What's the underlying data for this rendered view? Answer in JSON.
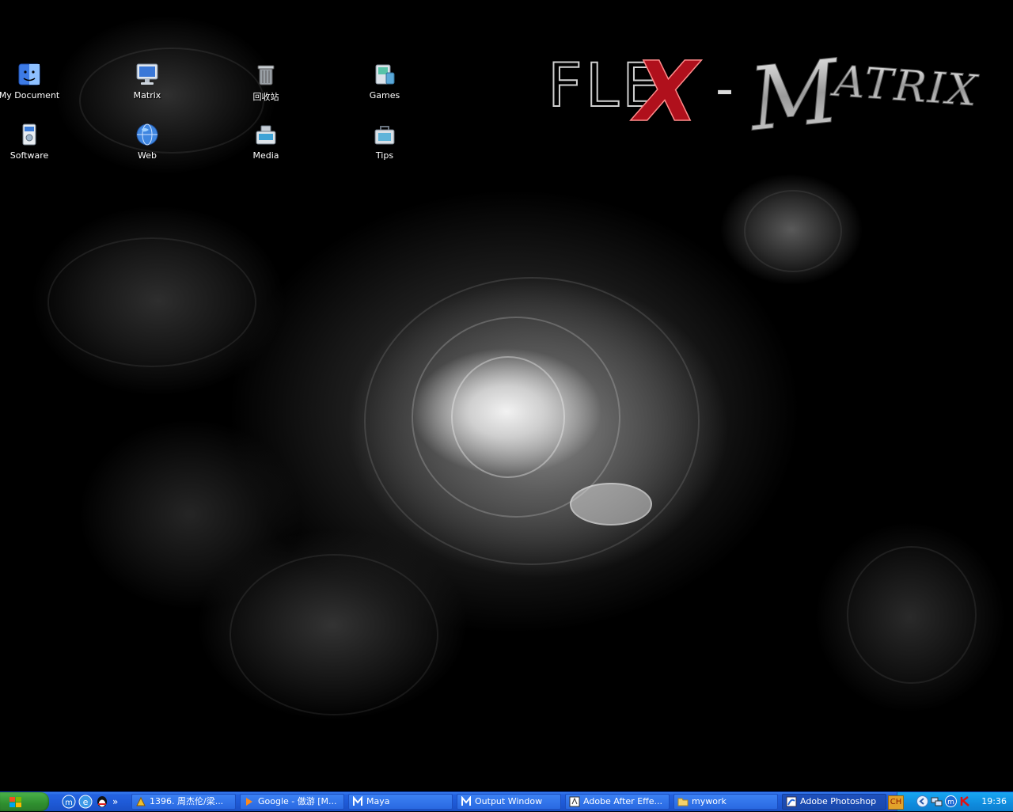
{
  "desktop": {
    "icons": [
      {
        "label": "My Document",
        "icon": "finder-icon"
      },
      {
        "label": "Matrix",
        "icon": "computer-icon"
      },
      {
        "label": "回收站",
        "icon": "trash-icon"
      },
      {
        "label": "Games",
        "icon": "games-icon"
      },
      {
        "label": "Software",
        "icon": "software-icon"
      },
      {
        "label": "Web",
        "icon": "globe-icon"
      },
      {
        "label": "Media",
        "icon": "media-icon"
      },
      {
        "label": "Tips",
        "icon": "toolbox-icon"
      }
    ],
    "logo": {
      "part1": "FLE",
      "part2": "X",
      "part3": "-",
      "part4": "ATRIX",
      "letter_m": "M"
    }
  },
  "taskbar": {
    "start_icon": "windows-logo-icon",
    "quick_launch": [
      "maxthon-icon",
      "ie-icon",
      "qq-icon"
    ],
    "overflow": "»",
    "tasks": [
      {
        "label": "1396. 周杰伦/梁...",
        "icon": "music-icon"
      },
      {
        "label": "Google - 傲游 [M...",
        "icon": "browser-icon"
      },
      {
        "label": "Maya",
        "icon": "maya-icon"
      },
      {
        "label": "Output Window",
        "icon": "maya-icon"
      },
      {
        "label": "Adobe After Effe...",
        "icon": "after-effects-icon"
      },
      {
        "label": "mywork",
        "icon": "folder-icon"
      },
      {
        "label": "Adobe Photoshop",
        "icon": "photoshop-icon"
      }
    ],
    "tray": {
      "language": "CH",
      "clock": "19:36",
      "icons": [
        "back-arrow-icon",
        "network-icon",
        "maxthon-icon",
        "kaspersky-icon"
      ]
    }
  },
  "colors": {
    "taskbar_blue": "#2563e0",
    "start_green": "#2f8f2f",
    "tray_blue": "#0f8cde",
    "logo_red": "#b0101c"
  }
}
